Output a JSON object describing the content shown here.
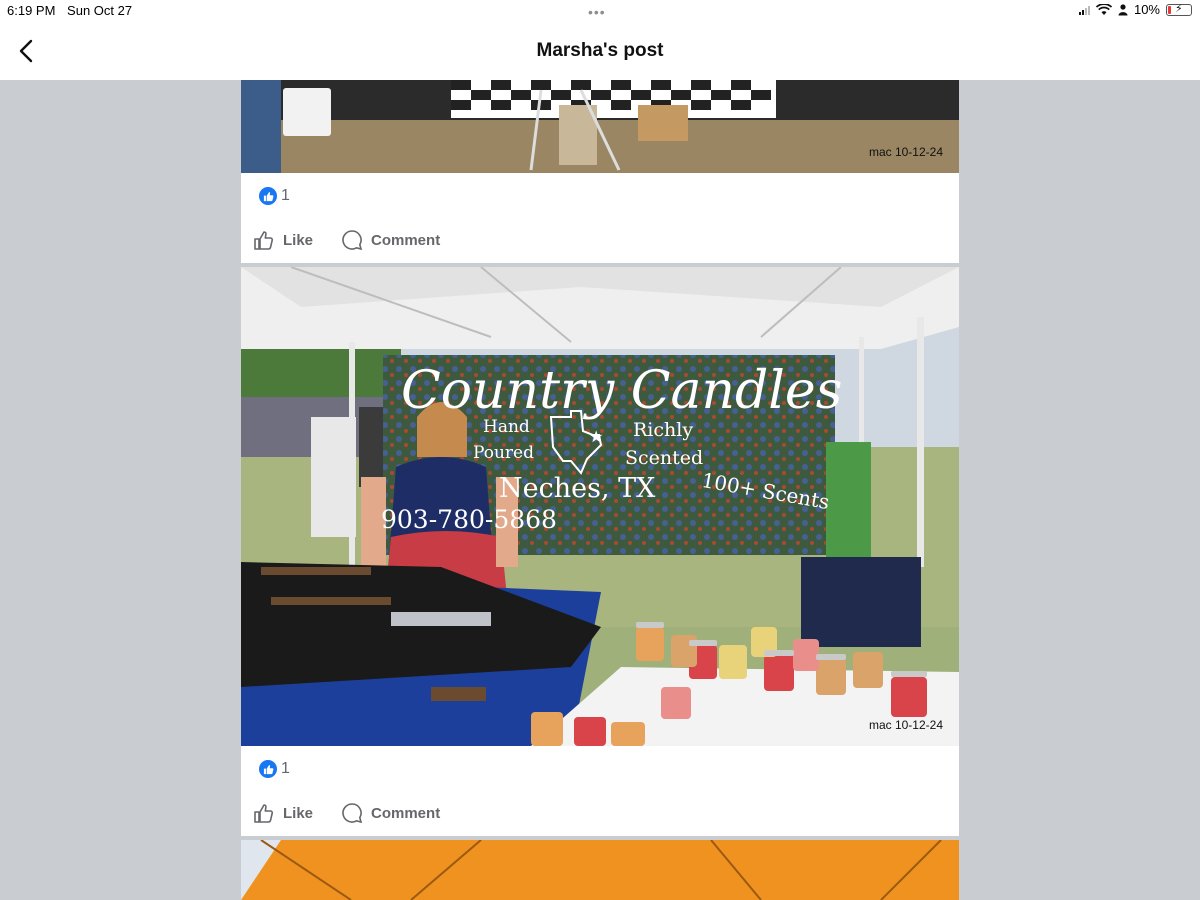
{
  "status_bar": {
    "time": "6:19 PM",
    "date": "Sun Oct 27",
    "battery_percent": "10%",
    "battery_level": 0.1,
    "icons": [
      "signal-icon",
      "wifi-icon",
      "person-icon",
      "battery-charging-icon"
    ]
  },
  "nav": {
    "title": "Marsha's post",
    "back_icon": "chevron-left-icon"
  },
  "posts": [
    {
      "watermark": "mac 10-12-24",
      "reaction_count": "1",
      "like_label": "Like",
      "comment_label": "Comment"
    },
    {
      "watermark": "mac 10-12-24",
      "reaction_count": "1",
      "like_label": "Like",
      "comment_label": "Comment",
      "banner": {
        "title": "Country Candles",
        "line_left_1": "Hand",
        "line_left_2": "Poured",
        "line_right_1": "Richly",
        "line_right_2": "Scented",
        "location": "Neches, TX",
        "scents": "100+ Scents",
        "phone": "903-780-5868"
      }
    }
  ],
  "colors": {
    "accent": "#1877f2",
    "background": "#c9ccd1",
    "action_text": "#65676b"
  }
}
